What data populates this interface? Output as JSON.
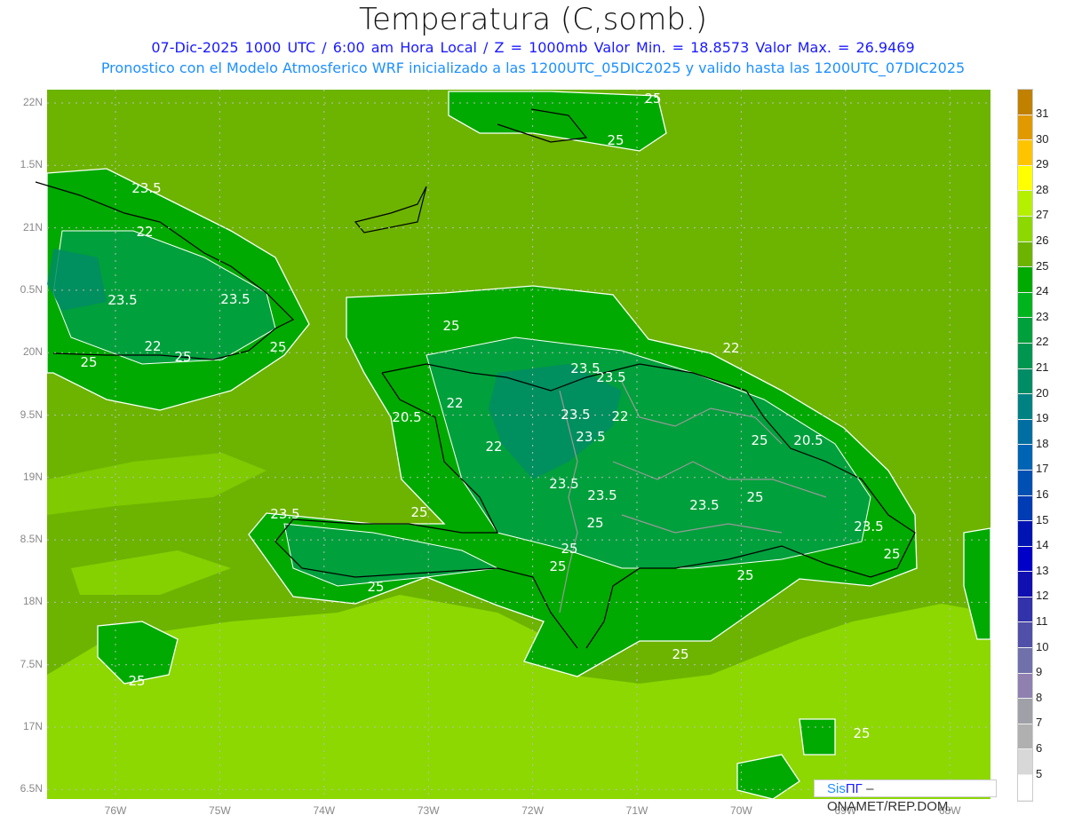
{
  "header": {
    "title": "Temperatura (C,somb.)",
    "subtitle": "07-Dic-2025  1000 UTC / 6:00 am Hora Local / Z = 1000mb   Valor Min. = 18.8573  Valor Max. = 26.9469",
    "model_info": "Pronostico con el Modelo Atmosferico WRF inicializado a las 1200UTC_05DIC2025 y valido hasta las  1200UTC_07DIC2025"
  },
  "axes": {
    "lat_labels": [
      "22N",
      "1.5N",
      "21N",
      "0.5N",
      "20N",
      "9.5N",
      "19N",
      "8.5N",
      "18N",
      "7.5N",
      "17N",
      "6.5N"
    ],
    "lon_labels": [
      "76W",
      "75W",
      "74W",
      "73W",
      "72W",
      "71W",
      "70W",
      "69W",
      "68W"
    ]
  },
  "colorbar": {
    "labels": [
      "31",
      "30",
      "29",
      "28",
      "27",
      "26",
      "25",
      "24",
      "23",
      "22",
      "21",
      "20",
      "19",
      "18",
      "17",
      "16",
      "15",
      "14",
      "13",
      "12",
      "11",
      "10",
      "9",
      "8",
      "7",
      "6",
      "5"
    ],
    "colors": [
      "#c08000",
      "#e09a00",
      "#ffc400",
      "#ffff00",
      "#b4f000",
      "#8cd800",
      "#6cb400",
      "#00aa00",
      "#00b41e",
      "#00a03c",
      "#009650",
      "#008c64",
      "#008282",
      "#006ea0",
      "#0064b4",
      "#0050b4",
      "#003cb4",
      "#0014b4",
      "#0000c8",
      "#1010b0",
      "#3232aa",
      "#5050a8",
      "#7070aa",
      "#9080b0",
      "#a0a0a8",
      "#b0b0b0",
      "#d8d8d8",
      "#ffffff"
    ]
  },
  "contour_labels": [
    "25",
    "25",
    "23.5",
    "22",
    "23.5",
    "23.5",
    "22",
    "25",
    "25",
    "25",
    "25",
    "22",
    "23.5",
    "23.5",
    "22",
    "20.5",
    "23.5",
    "22",
    "23.5",
    "25",
    "20.5",
    "22",
    "23.5",
    "25",
    "23.5",
    "23.5",
    "25",
    "25",
    "23.5",
    "23.5",
    "25",
    "25",
    "25",
    "25",
    "25",
    "25",
    "25",
    "25"
  ],
  "watermark": {
    "sis": "Sis",
    "pi": "ΠΓ",
    "rest": " – ONAMET/REP.DOM."
  }
}
